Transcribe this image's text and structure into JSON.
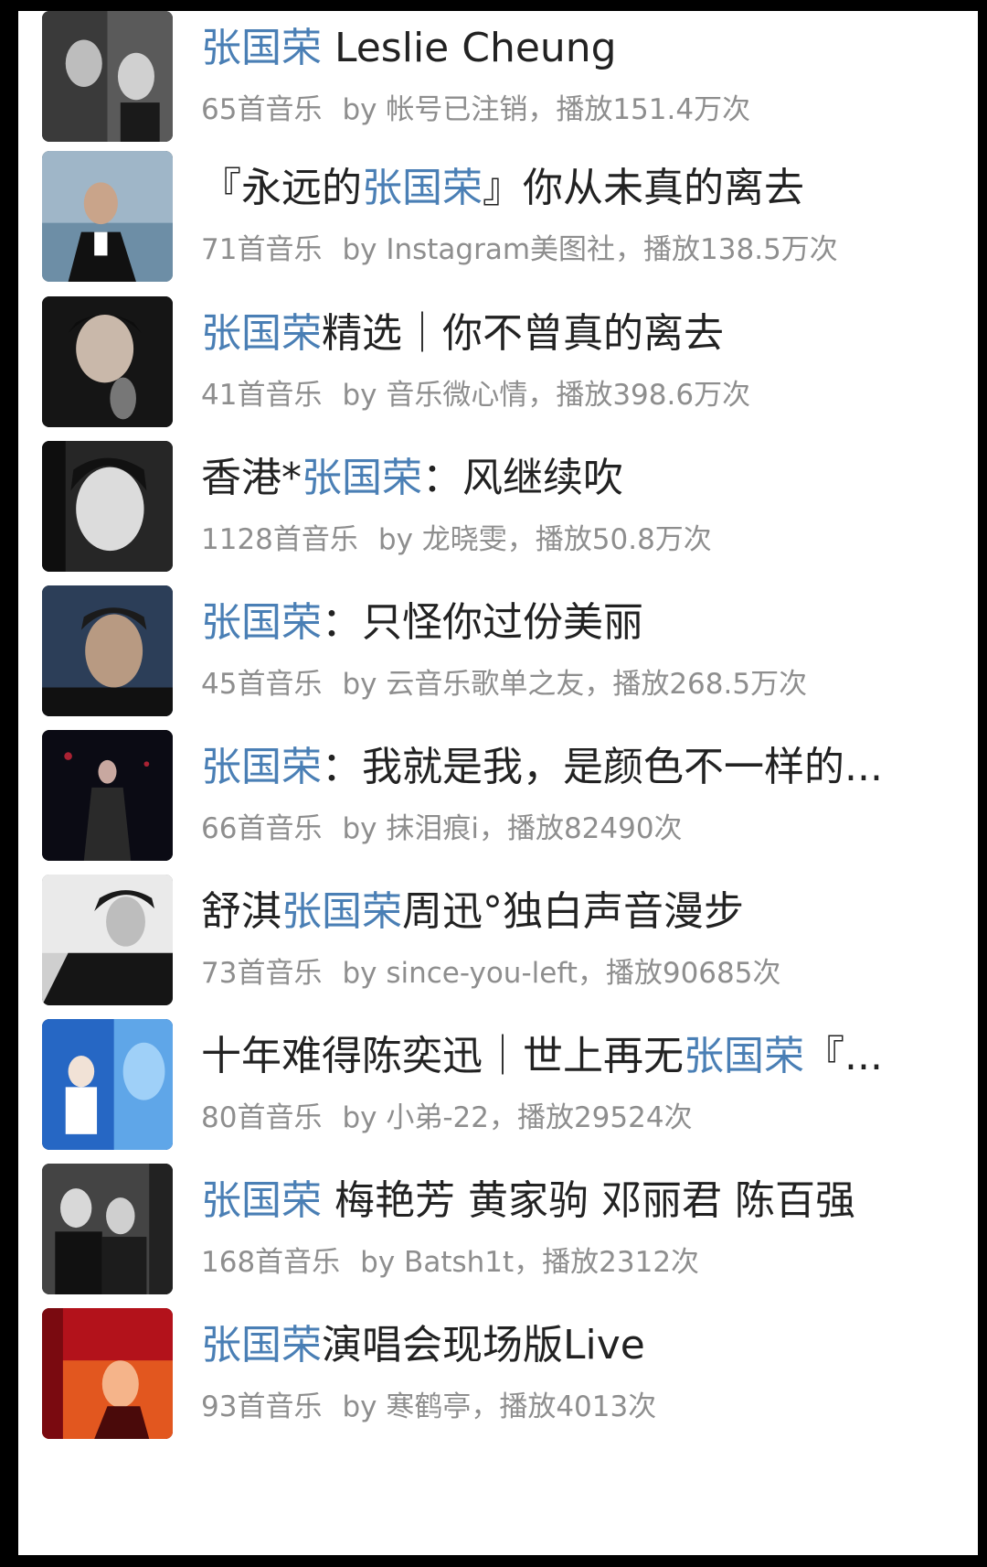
{
  "colors": {
    "highlight": "#4a7fb5",
    "title": "#222222",
    "meta": "#8e8e8e",
    "background": "#ffffff"
  },
  "playlists": [
    {
      "cover": "album-cover-1",
      "title": [
        {
          "t": "张国荣",
          "h": true
        },
        {
          "t": " Leslie Cheung",
          "h": false
        }
      ],
      "count": "65首音乐",
      "meta": "by 帐号已注销，播放151.4万次"
    },
    {
      "cover": "album-cover-2",
      "title": [
        {
          "t": "『永远的",
          "h": false
        },
        {
          "t": "张国荣",
          "h": true
        },
        {
          "t": "』你从未真的离去",
          "h": false
        }
      ],
      "count": "71首音乐",
      "meta": "by Instagram美图社，播放138.5万次"
    },
    {
      "cover": "album-cover-3",
      "title": [
        {
          "t": "张国荣",
          "h": true
        },
        {
          "t": "精选｜你不曾真的离去",
          "h": false
        }
      ],
      "count": "41首音乐",
      "meta": "by 音乐微心情，播放398.6万次"
    },
    {
      "cover": "album-cover-4",
      "title": [
        {
          "t": "香港*",
          "h": false
        },
        {
          "t": "张国荣",
          "h": true
        },
        {
          "t": "：风继续吹",
          "h": false
        }
      ],
      "count": "1128首音乐",
      "meta": "by 龙晓雯，播放50.8万次"
    },
    {
      "cover": "album-cover-5",
      "title": [
        {
          "t": "张国荣",
          "h": true
        },
        {
          "t": "：只怪你过份美丽",
          "h": false
        }
      ],
      "count": "45首音乐",
      "meta": "by 云音乐歌单之友，播放268.5万次"
    },
    {
      "cover": "album-cover-6",
      "title": [
        {
          "t": "张国荣",
          "h": true
        },
        {
          "t": "：我就是我，是颜色不一样的...",
          "h": false
        }
      ],
      "count": "66首音乐",
      "meta": "by 抹泪痕i，播放82490次"
    },
    {
      "cover": "album-cover-7",
      "title": [
        {
          "t": "舒淇",
          "h": false
        },
        {
          "t": "张国荣",
          "h": true
        },
        {
          "t": "周迅°独白声音漫步",
          "h": false
        }
      ],
      "count": "73首音乐",
      "meta": "by since-you-left，播放90685次"
    },
    {
      "cover": "album-cover-8",
      "title": [
        {
          "t": "十年难得陈奕迅｜世上再无",
          "h": false
        },
        {
          "t": "张国荣",
          "h": true
        },
        {
          "t": "『...",
          "h": false
        }
      ],
      "count": "80首音乐",
      "meta": "by 小弟-22，播放29524次"
    },
    {
      "cover": "album-cover-9",
      "title": [
        {
          "t": "张国荣",
          "h": true
        },
        {
          "t": " 梅艳芳 黄家驹 邓丽君 陈百强",
          "h": false
        }
      ],
      "count": "168首音乐",
      "meta": "by Batsh1t，播放2312次"
    },
    {
      "cover": "album-cover-10",
      "title": [
        {
          "t": "张国荣",
          "h": true
        },
        {
          "t": "演唱会现场版Live",
          "h": false
        }
      ],
      "count": "93首音乐",
      "meta": "by 寒鹤亭，播放4013次"
    }
  ]
}
